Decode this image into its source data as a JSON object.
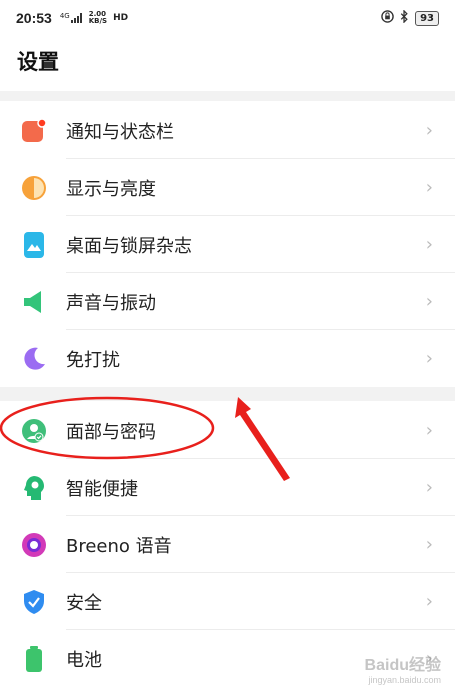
{
  "status_bar": {
    "time": "20:53",
    "network_type": "4G",
    "speed_value": "2.00",
    "speed_unit": "KB/S",
    "hd_label": "HD",
    "battery": "93"
  },
  "page": {
    "title": "设置"
  },
  "items": [
    {
      "label": "通知与状态栏",
      "icon": "notification-icon",
      "color": "#f36a4b"
    },
    {
      "label": "显示与亮度",
      "icon": "brightness-icon",
      "color": "#f7a23a"
    },
    {
      "label": "桌面与锁屏杂志",
      "icon": "wallpaper-icon",
      "color": "#2bb7e8"
    },
    {
      "label": "声音与振动",
      "icon": "speaker-icon",
      "color": "#33c47a"
    },
    {
      "label": "免打扰",
      "icon": "moon-icon",
      "color": "#9b6cf2"
    },
    {
      "label": "面部与密码",
      "icon": "face-password-icon",
      "color": "#3fbf7a"
    },
    {
      "label": "智能便捷",
      "icon": "smart-head-icon",
      "color": "#25b973"
    },
    {
      "label": "Breeno 语音",
      "icon": "breeno-icon",
      "color": "#d23ab8"
    },
    {
      "label": "安全",
      "icon": "shield-icon",
      "color": "#2f8cf0"
    },
    {
      "label": "电池",
      "icon": "battery-icon",
      "color": "#3dc46c"
    }
  ],
  "chevron": "›",
  "watermark": {
    "text": "Baidu经验",
    "sub": "jingyan.baidu.com"
  },
  "annotation_color": "#e8201c"
}
